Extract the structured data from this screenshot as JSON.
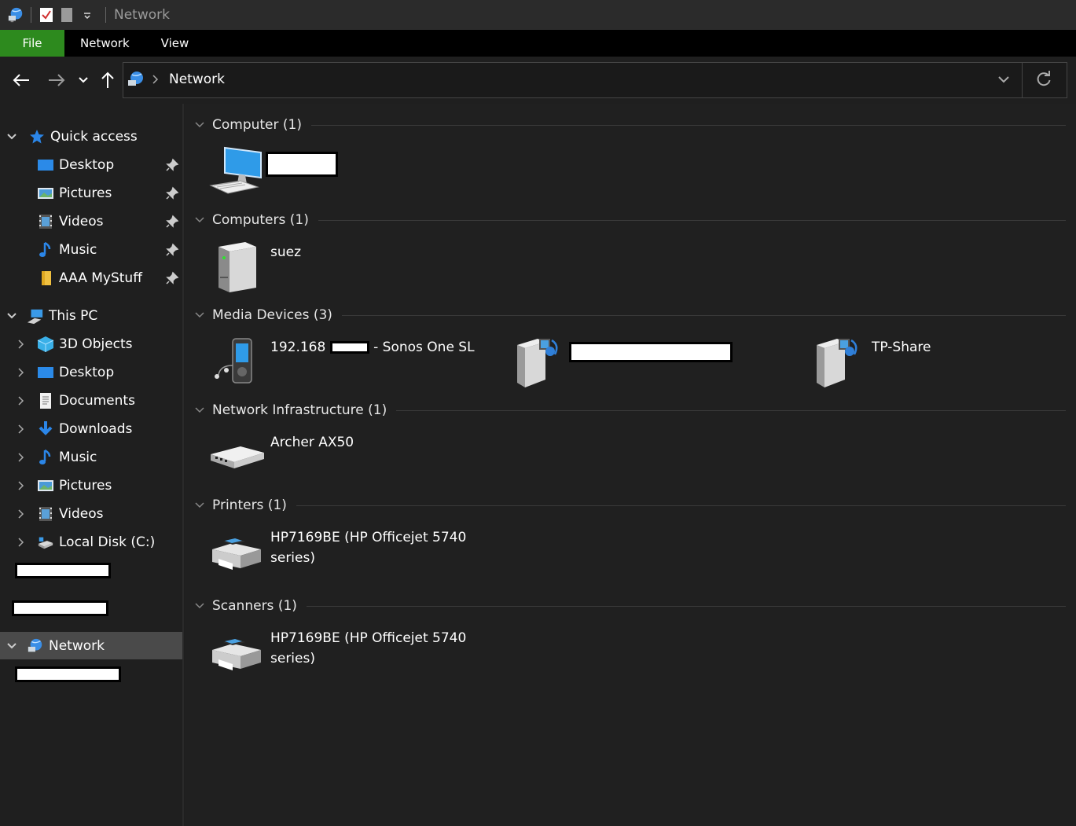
{
  "window": {
    "title": "Network"
  },
  "ribbon": {
    "tabs": [
      {
        "label": "File"
      },
      {
        "label": "Network"
      },
      {
        "label": "View"
      }
    ]
  },
  "address": {
    "location": "Network"
  },
  "nav": {
    "quick_access": {
      "label": "Quick access",
      "items": [
        {
          "label": "Desktop"
        },
        {
          "label": "Pictures"
        },
        {
          "label": "Videos"
        },
        {
          "label": "Music"
        },
        {
          "label": "AAA MyStuff"
        }
      ]
    },
    "this_pc": {
      "label": "This PC",
      "items": [
        {
          "label": "3D Objects"
        },
        {
          "label": "Desktop"
        },
        {
          "label": "Documents"
        },
        {
          "label": "Downloads"
        },
        {
          "label": "Music"
        },
        {
          "label": "Pictures"
        },
        {
          "label": "Videos"
        },
        {
          "label": "Local Disk (C:)"
        }
      ]
    },
    "network": {
      "label": "Network"
    }
  },
  "groups": [
    {
      "label": "Computer (1)",
      "items": [
        {
          "label": ""
        }
      ]
    },
    {
      "label": "Computers (1)",
      "items": [
        {
          "label": "suez"
        }
      ]
    },
    {
      "label": "Media Devices (3)",
      "items": [
        {
          "label_prefix": "192.168",
          "label_suffix": "- Sonos One SL"
        },
        {
          "label": ""
        },
        {
          "label": "TP-Share"
        }
      ]
    },
    {
      "label": "Network Infrastructure (1)",
      "items": [
        {
          "label": "Archer AX50"
        }
      ]
    },
    {
      "label": "Printers (1)",
      "items": [
        {
          "line1": "HP7169BE (HP Officejet 5740",
          "line2": "series)"
        }
      ]
    },
    {
      "label": "Scanners (1)",
      "items": [
        {
          "line1": "HP7169BE (HP Officejet 5740",
          "line2": "series)"
        }
      ]
    }
  ],
  "colors": {
    "file_tab": "#2d8a1e",
    "selected": "#4a4a4a",
    "background": "#1f1f1f",
    "accent": "#1e90ff"
  }
}
